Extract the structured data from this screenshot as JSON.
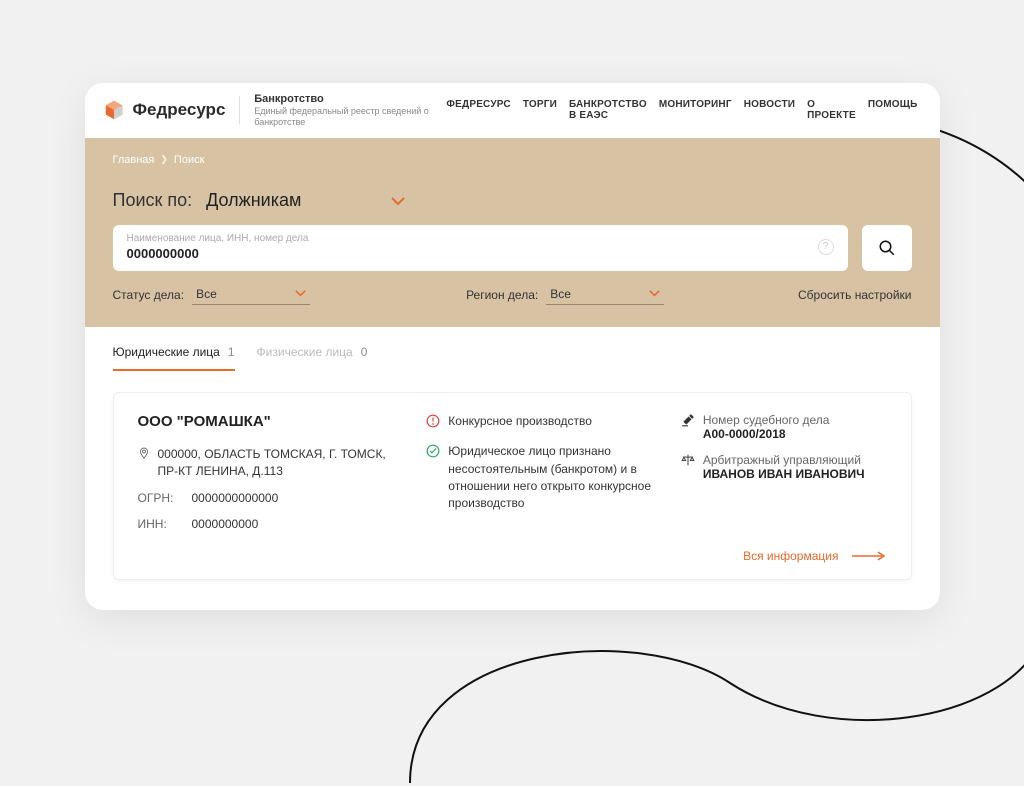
{
  "header": {
    "brand": "Федресурс",
    "subTitle": "Банкротство",
    "subDesc": "Единый федеральный реестр сведений о банкротстве",
    "nav": [
      "ФЕДРЕСУРС",
      "ТОРГИ",
      "БАНКРОТСТВО В ЕАЭС",
      "МОНИТОРИНГ",
      "НОВОСТИ",
      "О ПРОЕКТЕ",
      "ПОМОЩЬ"
    ]
  },
  "crumbs": {
    "home": "Главная",
    "current": "Поиск"
  },
  "search": {
    "titleLabel": "Поиск по:",
    "category": "Должникам",
    "placeholder": "Наименование лица, ИНН, номер дела",
    "value": "0000000000",
    "statusLabel": "Статус дела:",
    "statusValue": "Все",
    "regionLabel": "Регион дела:",
    "regionValue": "Все",
    "reset": "Сбросить настройки"
  },
  "tabs": {
    "legal": {
      "label": "Юридические лица",
      "count": "1"
    },
    "person": {
      "label": "Физические лица",
      "count": "0"
    }
  },
  "result": {
    "name": "ООО \"РОМАШКА\"",
    "address": "000000, ОБЛАСТЬ ТОМСКАЯ, Г. ТОМСК, ПР-КТ ЛЕНИНА, Д.113",
    "ogrnLabel": "ОГРН:",
    "ogrn": "0000000000000",
    "innLabel": "ИНН:",
    "inn": "0000000000",
    "stage": "Конкурсное производство",
    "status": "Юридическое лицо признано несостоятельным (банкротом) и в отношении него открыто конкурсное производство",
    "caseLabel": "Номер судебного дела",
    "caseNo": "А00-0000/2018",
    "managerLabel": "Арбитражный управляющий",
    "manager": "ИВАНОВ ИВАН ИВАНОВИЧ",
    "more": "Вся информация"
  }
}
